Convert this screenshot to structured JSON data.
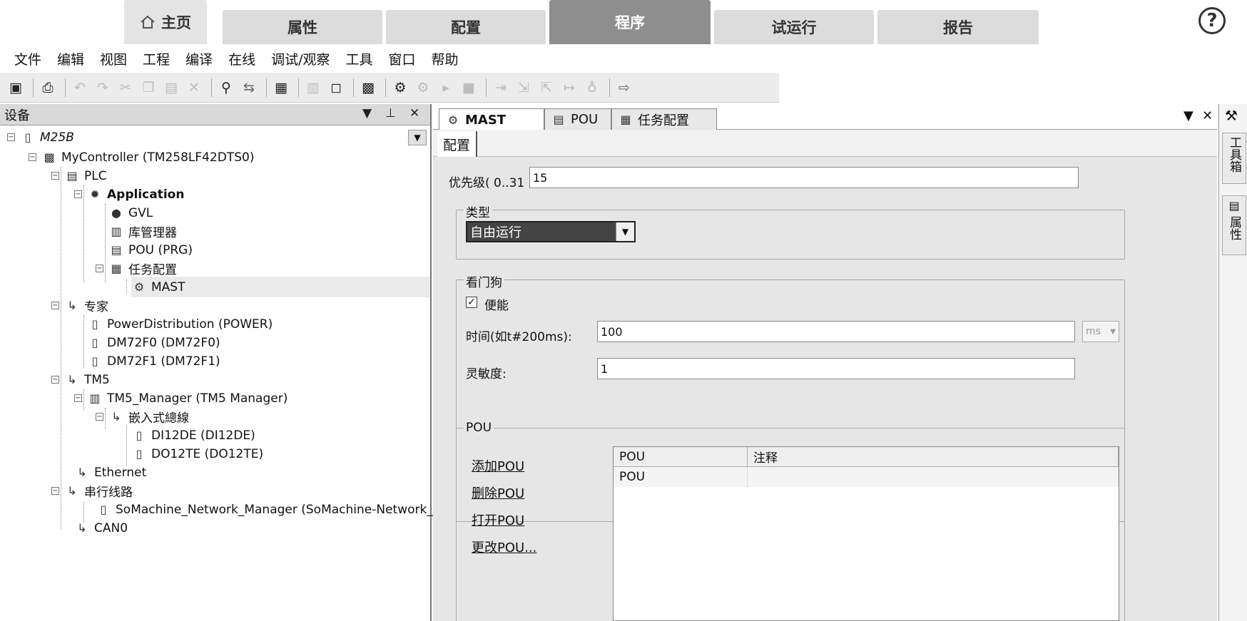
{
  "top_tabs": [
    {
      "label": "主页"
    },
    {
      "label": "属性"
    },
    {
      "label": "配置"
    },
    {
      "label": "程序"
    },
    {
      "label": "试运行"
    },
    {
      "label": "报告"
    }
  ],
  "help_label": "?",
  "menu": [
    "文件",
    "编辑",
    "视图",
    "工程",
    "编译",
    "在线",
    "调试/观察",
    "工具",
    "窗口",
    "帮助"
  ],
  "device_panel": {
    "title": "设备",
    "tree": [
      {
        "label": "M25B",
        "icon": "project-icon"
      },
      {
        "label": "MyController (TM258LF42DTS0)",
        "icon": "controller-icon"
      },
      {
        "label": "PLC",
        "icon": "plc-icon"
      },
      {
        "label": "Application",
        "icon": "gear-icon"
      },
      {
        "label": "GVL",
        "icon": "globe-icon"
      },
      {
        "label": "库管理器",
        "icon": "library-icon"
      },
      {
        "label": "POU (PRG)",
        "icon": "pou-icon"
      },
      {
        "label": "任务配置",
        "icon": "task-config-icon"
      },
      {
        "label": "MAST",
        "icon": "task-icon"
      },
      {
        "label": "专家",
        "icon": "bus-icon"
      },
      {
        "label": "PowerDistribution (POWER)",
        "icon": "module-icon"
      },
      {
        "label": "DM72F0 (DM72F0)",
        "icon": "module-icon"
      },
      {
        "label": "DM72F1 (DM72F1)",
        "icon": "module-icon"
      },
      {
        "label": "TM5",
        "icon": "bus-icon"
      },
      {
        "label": "TM5_Manager (TM5 Manager)",
        "icon": "manager-icon"
      },
      {
        "label": "嵌入式總線",
        "icon": "bus-icon"
      },
      {
        "label": "DI12DE (DI12DE)",
        "icon": "input-module-icon"
      },
      {
        "label": "DO12TE (DO12TE)",
        "icon": "output-module-icon"
      },
      {
        "label": "Ethernet",
        "icon": "bus-icon"
      },
      {
        "label": "串行线路",
        "icon": "bus-icon"
      },
      {
        "label": "SoMachine_Network_Manager (SoMachine-Network_",
        "icon": "network-manager-icon"
      },
      {
        "label": "CAN0",
        "icon": "bus-icon"
      }
    ]
  },
  "editor": {
    "tabs": [
      {
        "label": "MAST"
      },
      {
        "label": "POU"
      },
      {
        "label": "任务配置"
      }
    ],
    "subtab": "配置",
    "priority_label": "优先级( 0..31 ):",
    "priority_value": "15",
    "type_group": "类型",
    "type_value": "自由运行",
    "watchdog_group": "看门狗",
    "enable_label": "便能",
    "enable_checked": true,
    "time_label": "时间(如t#200ms):",
    "time_value": "100",
    "time_unit": "ms",
    "sensitivity_label": "灵敏度:",
    "sensitivity_value": "1",
    "pou_group": "POU",
    "links": [
      "添加POU",
      "删除POU",
      "打开POU",
      "更改POU..."
    ],
    "table_headers": [
      "POU",
      "注释"
    ],
    "table_rows": [
      [
        "POU",
        ""
      ]
    ]
  },
  "right_strip": {
    "toolbox": "工具箱",
    "properties": "属性"
  },
  "colors": {
    "active_tab": "#8e8e8e",
    "tab_inactive": "#dcdcdc",
    "editor_bg": "#e6e6e6"
  }
}
